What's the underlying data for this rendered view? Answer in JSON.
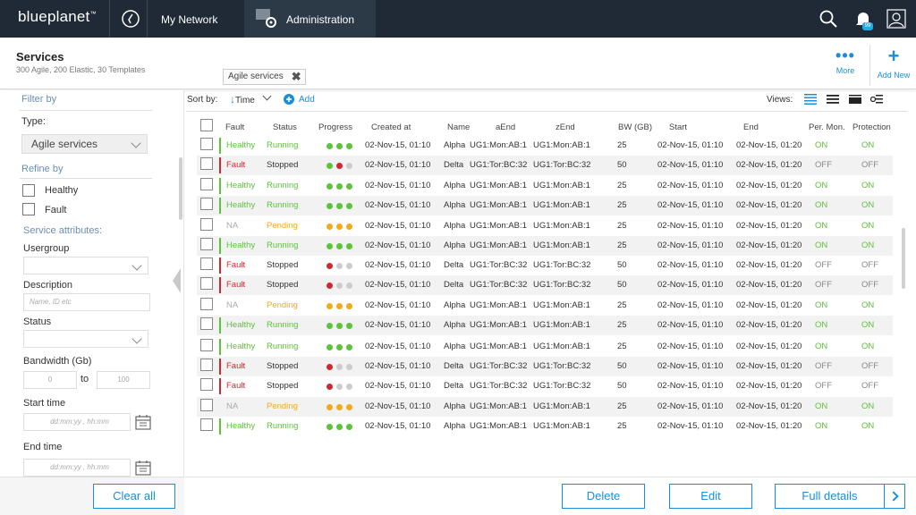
{
  "topbar": {
    "brand_a": "blue",
    "brand_b": "planet",
    "brand_tm": "™",
    "nav_network": "My Network",
    "nav_admin": "Administration",
    "notif_count": "99",
    "icons": [
      "compass-icon",
      "admin-gear-icon",
      "search-icon",
      "bell-icon",
      "user-icon"
    ]
  },
  "header": {
    "title": "Services",
    "subtitle": "300 Agile, 200 Elastic, 30 Templates",
    "chip": "Agile services",
    "chip_close": "✖",
    "more_label": "More",
    "add_label": "Add New"
  },
  "sidebar": {
    "filter_by": "Filter by",
    "type_label": "Type:",
    "type_value": "Agile services",
    "refine_by": "Refine by",
    "healthy": "Healthy",
    "fault": "Fault",
    "attributes": "Service attributes:",
    "usergroup": "Usergroup",
    "description": "Description",
    "description_placeholder": "Name, ID etc",
    "status": "Status",
    "bandwidth": "Bandwidth (Gb)",
    "bw_min": "0",
    "bw_to": "to",
    "bw_max": "100",
    "start_time": "Start time",
    "end_time": "End time",
    "time_placeholder": "dd:mm:yy  ,  hh:mm",
    "clear_all": "Clear all"
  },
  "toolbar": {
    "sort_by": "Sort by:",
    "sort_field": "Time",
    "add": "Add",
    "views": "Views:"
  },
  "table": {
    "columns": [
      "Fault",
      "Status",
      "Progress",
      "Created at",
      "Name",
      "aEnd",
      "zEnd",
      "BW (GB)",
      "Start",
      "End",
      "Per. Mon.",
      "Protection"
    ],
    "rows": [
      {
        "fault": "Healthy",
        "status": "Running",
        "progress": [
          "g",
          "g",
          "g"
        ],
        "created": "02-Nov-15, 01:10",
        "name": "Alpha",
        "aend": "UG1:Mon:AB:1",
        "zend": "UG1:Mon:AB:1",
        "bw": "25",
        "start": "02-Nov-15, 01:10",
        "end": "02-Nov-15, 01:20",
        "permon": "ON",
        "protection": "ON"
      },
      {
        "fault": "Fault",
        "status": "Stopped",
        "progress": [
          "g",
          "r",
          "x"
        ],
        "created": "02-Nov-15, 01:10",
        "name": "Delta",
        "aend": "UG1:Tor:BC:32",
        "zend": "UG1:Tor:BC:32",
        "bw": "50",
        "start": "02-Nov-15, 01:10",
        "end": "02-Nov-15, 01:20",
        "permon": "OFF",
        "protection": "OFF"
      },
      {
        "fault": "Healthy",
        "status": "Running",
        "progress": [
          "g",
          "g",
          "g"
        ],
        "created": "02-Nov-15, 01:10",
        "name": "Alpha",
        "aend": "UG1:Mon:AB:1",
        "zend": "UG1:Mon:AB:1",
        "bw": "25",
        "start": "02-Nov-15, 01:10",
        "end": "02-Nov-15, 01:20",
        "permon": "ON",
        "protection": "ON"
      },
      {
        "fault": "Healthy",
        "status": "Running",
        "progress": [
          "g",
          "g",
          "g"
        ],
        "created": "02-Nov-15, 01:10",
        "name": "Alpha",
        "aend": "UG1:Mon:AB:1",
        "zend": "UG1:Mon:AB:1",
        "bw": "25",
        "start": "02-Nov-15, 01:10",
        "end": "02-Nov-15, 01:20",
        "permon": "ON",
        "protection": "ON"
      },
      {
        "fault": "NA",
        "status": "Pending",
        "progress": [
          "y",
          "y",
          "y"
        ],
        "created": "02-Nov-15, 01:10",
        "name": "Alpha",
        "aend": "UG1:Mon:AB:1",
        "zend": "UG1:Mon:AB:1",
        "bw": "25",
        "start": "02-Nov-15, 01:10",
        "end": "02-Nov-15, 01:20",
        "permon": "ON",
        "protection": "ON"
      },
      {
        "fault": "Healthy",
        "status": "Running",
        "progress": [
          "g",
          "g",
          "g"
        ],
        "created": "02-Nov-15, 01:10",
        "name": "Alpha",
        "aend": "UG1:Mon:AB:1",
        "zend": "UG1:Mon:AB:1",
        "bw": "25",
        "start": "02-Nov-15, 01:10",
        "end": "02-Nov-15, 01:20",
        "permon": "ON",
        "protection": "ON"
      },
      {
        "fault": "Fault",
        "status": "Stopped",
        "progress": [
          "r",
          "x",
          "x"
        ],
        "created": "02-Nov-15, 01:10",
        "name": "Delta",
        "aend": "UG1:Tor:BC:32",
        "zend": "UG1:Tor:BC:32",
        "bw": "50",
        "start": "02-Nov-15, 01:10",
        "end": "02-Nov-15, 01:20",
        "permon": "OFF",
        "protection": "OFF"
      },
      {
        "fault": "Fault",
        "status": "Stopped",
        "progress": [
          "r",
          "x",
          "x"
        ],
        "created": "02-Nov-15, 01:10",
        "name": "Delta",
        "aend": "UG1:Tor:BC:32",
        "zend": "UG1:Tor:BC:32",
        "bw": "50",
        "start": "02-Nov-15, 01:10",
        "end": "02-Nov-15, 01:20",
        "permon": "OFF",
        "protection": "OFF"
      },
      {
        "fault": "NA",
        "status": "Pending",
        "progress": [
          "y",
          "y",
          "y"
        ],
        "created": "02-Nov-15, 01:10",
        "name": "Alpha",
        "aend": "UG1:Mon:AB:1",
        "zend": "UG1:Mon:AB:1",
        "bw": "25",
        "start": "02-Nov-15, 01:10",
        "end": "02-Nov-15, 01:20",
        "permon": "ON",
        "protection": "ON"
      },
      {
        "fault": "Healthy",
        "status": "Running",
        "progress": [
          "g",
          "g",
          "g"
        ],
        "created": "02-Nov-15, 01:10",
        "name": "Alpha",
        "aend": "UG1:Mon:AB:1",
        "zend": "UG1:Mon:AB:1",
        "bw": "25",
        "start": "02-Nov-15, 01:10",
        "end": "02-Nov-15, 01:20",
        "permon": "ON",
        "protection": "ON"
      },
      {
        "fault": "Healthy",
        "status": "Running",
        "progress": [
          "g",
          "g",
          "g"
        ],
        "created": "02-Nov-15, 01:10",
        "name": "Alpha",
        "aend": "UG1:Mon:AB:1",
        "zend": "UG1:Mon:AB:1",
        "bw": "25",
        "start": "02-Nov-15, 01:10",
        "end": "02-Nov-15, 01:20",
        "permon": "ON",
        "protection": "ON"
      },
      {
        "fault": "Fault",
        "status": "Stopped",
        "progress": [
          "r",
          "x",
          "x"
        ],
        "created": "02-Nov-15, 01:10",
        "name": "Delta",
        "aend": "UG1:Tor:BC:32",
        "zend": "UG1:Tor:BC:32",
        "bw": "50",
        "start": "02-Nov-15, 01:10",
        "end": "02-Nov-15, 01:20",
        "permon": "OFF",
        "protection": "OFF"
      },
      {
        "fault": "Fault",
        "status": "Stopped",
        "progress": [
          "r",
          "x",
          "x"
        ],
        "created": "02-Nov-15, 01:10",
        "name": "Delta",
        "aend": "UG1:Tor:BC:32",
        "zend": "UG1:Tor:BC:32",
        "bw": "50",
        "start": "02-Nov-15, 01:10",
        "end": "02-Nov-15, 01:20",
        "permon": "OFF",
        "protection": "OFF"
      },
      {
        "fault": "NA",
        "status": "Pending",
        "progress": [
          "y",
          "y",
          "y"
        ],
        "created": "02-Nov-15, 01:10",
        "name": "Alpha",
        "aend": "UG1:Mon:AB:1",
        "zend": "UG1:Mon:AB:1",
        "bw": "25",
        "start": "02-Nov-15, 01:10",
        "end": "02-Nov-15, 01:20",
        "permon": "ON",
        "protection": "ON"
      },
      {
        "fault": "Healthy",
        "status": "Running",
        "progress": [
          "g",
          "g",
          "g"
        ],
        "created": "02-Nov-15, 01:10",
        "name": "Alpha",
        "aend": "UG1:Mon:AB:1",
        "zend": "UG1:Mon:AB:1",
        "bw": "25",
        "start": "02-Nov-15, 01:10",
        "end": "02-Nov-15, 01:20",
        "permon": "ON",
        "protection": "ON"
      }
    ]
  },
  "footer": {
    "delete": "Delete",
    "edit": "Edit",
    "full_details": "Full details"
  },
  "colors": {
    "topbar_bg": "#1f2a36",
    "accent": "#1a8fd8",
    "healthy": "#5cc43a",
    "fault": "#d0282e",
    "pending": "#f2a91d",
    "na": "#aaaaaa",
    "dot_grey": "#cccccc"
  }
}
